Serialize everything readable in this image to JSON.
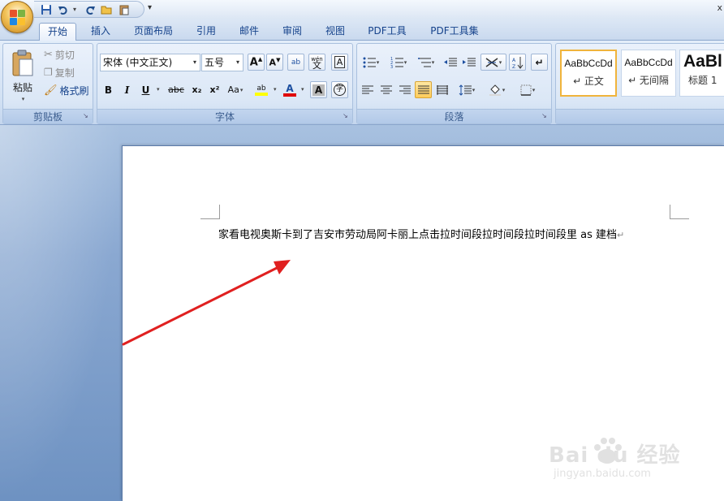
{
  "quick_access": {
    "items": [
      "save-icon",
      "undo-icon",
      "redo-icon",
      "open-folder-icon",
      "paste-icon"
    ],
    "customize_glyph": "▾"
  },
  "tabs": [
    {
      "label": "开始",
      "active": true
    },
    {
      "label": "插入"
    },
    {
      "label": "页面布局"
    },
    {
      "label": "引用"
    },
    {
      "label": "邮件"
    },
    {
      "label": "审阅"
    },
    {
      "label": "视图"
    },
    {
      "label": "PDF工具"
    },
    {
      "label": "PDF工具集"
    }
  ],
  "clipboard": {
    "paste_label": "粘贴",
    "cut_label": "剪切",
    "copy_label": "复制",
    "format_painter_label": "格式刷",
    "group_label": "剪贴板"
  },
  "font": {
    "font_name": "宋体 (中文正文)",
    "font_size": "五号",
    "grow_label": "A",
    "shrink_label": "A",
    "clear_label": "ab",
    "phonetic_label": "wén",
    "phonetic_char": "文",
    "border_label": "A",
    "bold": "B",
    "italic": "I",
    "underline": "U",
    "strike": "abc",
    "subscript": "x₂",
    "superscript": "x²",
    "case": "Aa",
    "highlight": "ab",
    "font_color": "A",
    "char_shading": "A",
    "enclose": "字",
    "group_label": "字体",
    "highlight_color": "#ffff00",
    "font_color_value": "#e00000"
  },
  "paragraph": {
    "group_label": "段落"
  },
  "styles": {
    "cards": [
      {
        "sample": "AaBbCcDd",
        "name": "↵ 正文"
      },
      {
        "sample": "AaBbCcDd",
        "name": "↵ 无间隔"
      },
      {
        "sample": "AaBl",
        "name": "标题 1"
      }
    ]
  },
  "document": {
    "text": "家看电视奥斯卡到了吉安市劳动局阿卡丽上点击拉时间段拉时间段拉时间段里 as 建档",
    "paragraph_mark": "↵"
  },
  "annotation": {
    "arrow_color": "#e02020"
  },
  "watermark": {
    "brand": "Bai du 经验",
    "sub": "jingyan.baidu.com"
  },
  "title_right": "x"
}
